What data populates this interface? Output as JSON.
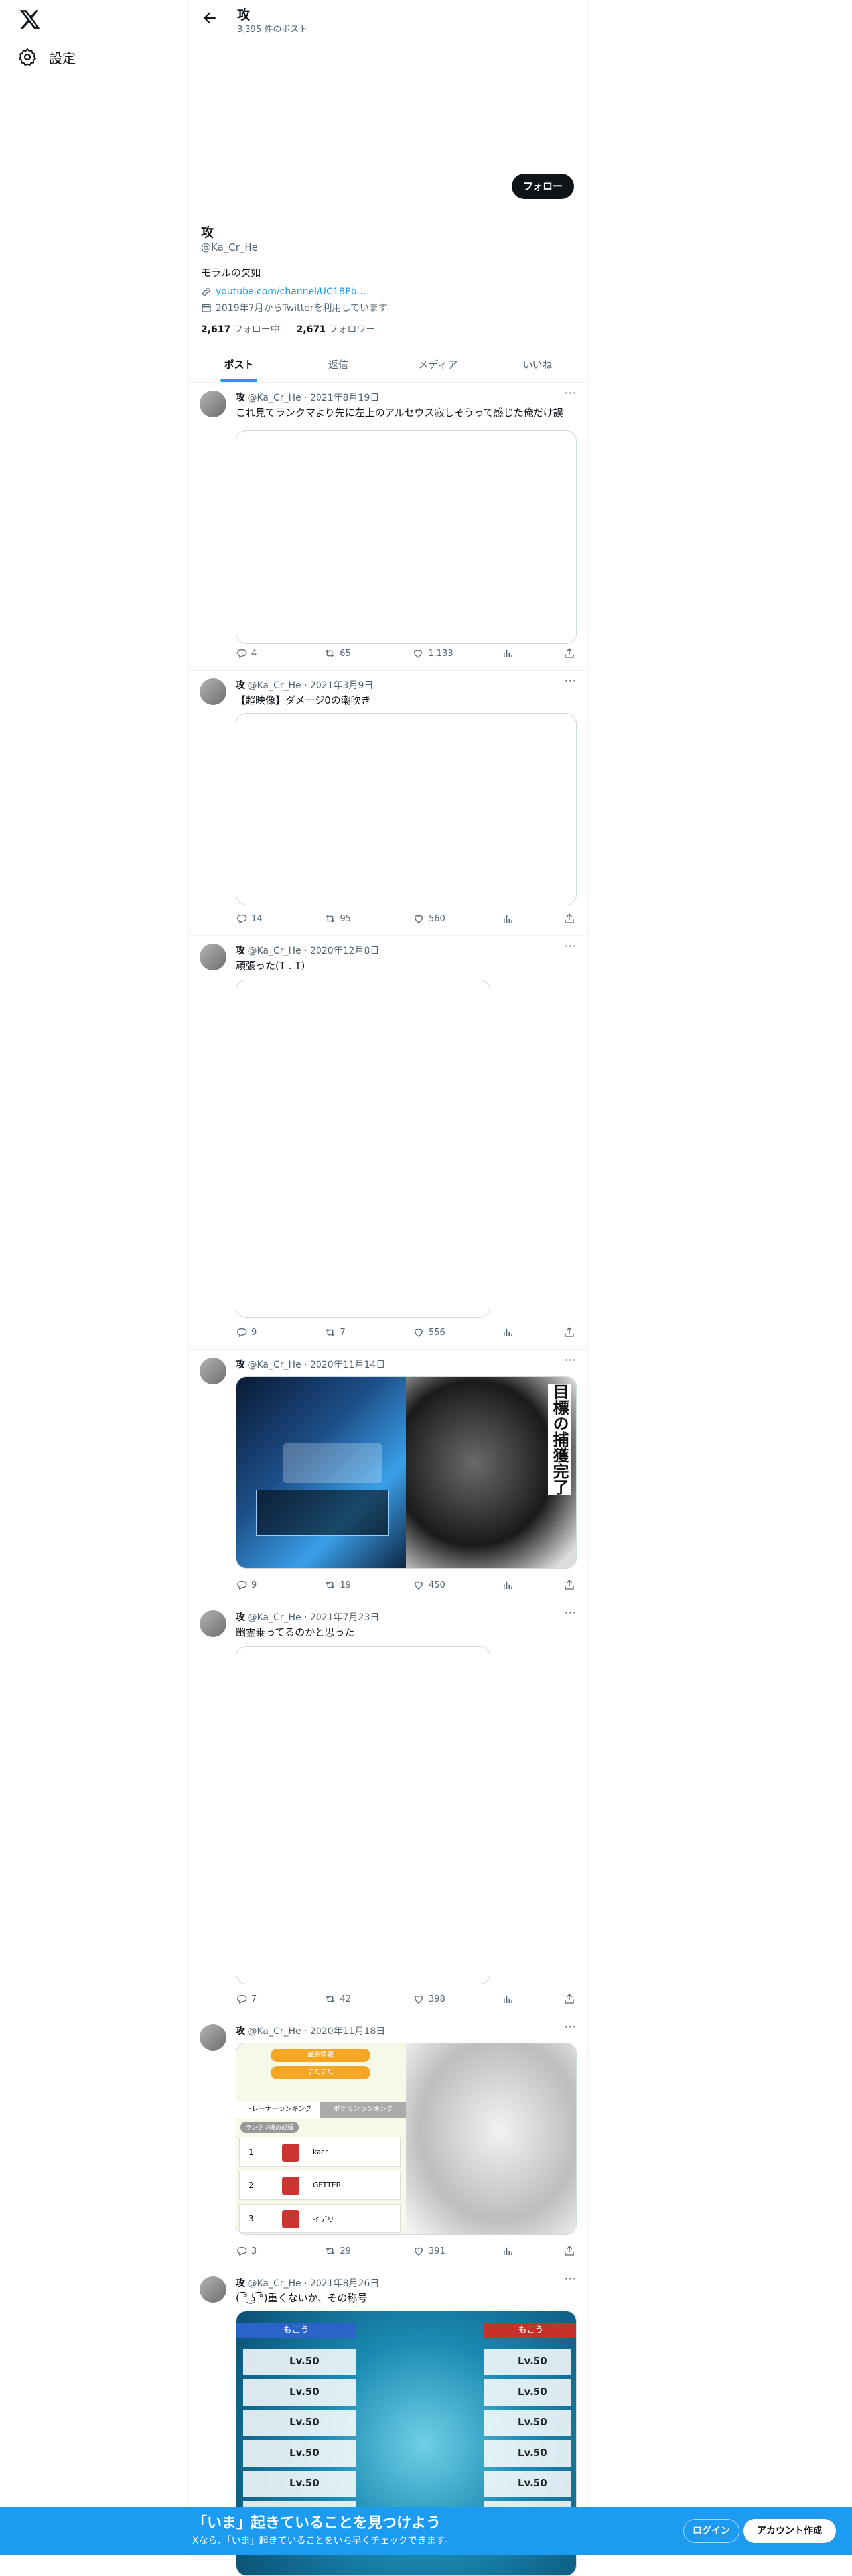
{
  "nav": {
    "settings_label": "設定"
  },
  "header": {
    "name": "攻",
    "post_count": "3,395 件のポスト"
  },
  "profile": {
    "name": "攻",
    "handle": "@Ka_Cr_He",
    "bio": "モラルの欠如",
    "link": "youtube.com/channel/UC1BPb…",
    "joined": "2019年7月からTwitterを利用しています",
    "following_count": "2,617",
    "following_label": "フォロー中",
    "followers_count": "2,671",
    "followers_label": "フォロワー",
    "follow_button": "フォロー"
  },
  "tabs": [
    "ポスト",
    "返信",
    "メディア",
    "いいね"
  ],
  "tweets": [
    {
      "name": "攻",
      "handle": "@Ka_Cr_He",
      "date": "2021年8月19日",
      "text": "これ見てランクマより先に左上のアルセウス寂しそうって感じた俺だけ誤",
      "replies": "4",
      "retweets": "65",
      "likes": "1,133",
      "media": "blank-wide"
    },
    {
      "name": "攻",
      "handle": "@Ka_Cr_He",
      "date": "2021年3月9日",
      "text": "【超映像】ダメージ0の潮吹き",
      "replies": "14",
      "retweets": "95",
      "likes": "560",
      "media": "blank-wide"
    },
    {
      "name": "攻",
      "handle": "@Ka_Cr_He",
      "date": "2020年12月8日",
      "text": "頑張った(T . T)",
      "replies": "9",
      "retweets": "7",
      "likes": "556",
      "media": "blank-tall"
    },
    {
      "name": "攻",
      "handle": "@Ka_Cr_He",
      "date": "2020年11月14日",
      "text": "",
      "replies": "9",
      "retweets": "19",
      "likes": "450",
      "media": "two-images"
    },
    {
      "name": "攻",
      "handle": "@Ka_Cr_He",
      "date": "2021年7月23日",
      "text": "幽霊乗ってるのかと思った",
      "replies": "7",
      "retweets": "42",
      "likes": "398",
      "media": "blank-tall"
    },
    {
      "name": "攻",
      "handle": "@Ka_Cr_He",
      "date": "2020年11月18日",
      "text": "",
      "replies": "3",
      "retweets": "29",
      "likes": "391",
      "media": "ranking-image"
    },
    {
      "name": "攻",
      "handle": "@Ka_Cr_He",
      "date": "2021年8月26日",
      "text": "(  ͡° ͜ʖ ͡°)重くないか、その称号",
      "media": "battle-image"
    }
  ],
  "ranking": {
    "button1": "最新情報",
    "button2": "まだまだ",
    "tab1": "トレーナーランキング",
    "tab2": "ポケモンランキング",
    "sub": "ランクマ戦の成績",
    "rows": [
      {
        "rank": "1",
        "name": "kacr"
      },
      {
        "rank": "2",
        "name": "GETTER"
      },
      {
        "rank": "3",
        "name": "イデリ"
      }
    ]
  },
  "manga_text": "目標の捕獲完了",
  "battle": {
    "left_title": "もこう",
    "right_title": "もこう",
    "level": "Lv.50"
  },
  "banner": {
    "title": "「いま」起きていることを見つけよう",
    "subtitle": "Xなら、「いま」起きていることをいち早くチェックできます。",
    "login": "ログイン",
    "signup": "アカウント作成"
  },
  "colors": {
    "accent": "#1d9bf0",
    "text": "#0f1419",
    "secondary": "#536471"
  }
}
